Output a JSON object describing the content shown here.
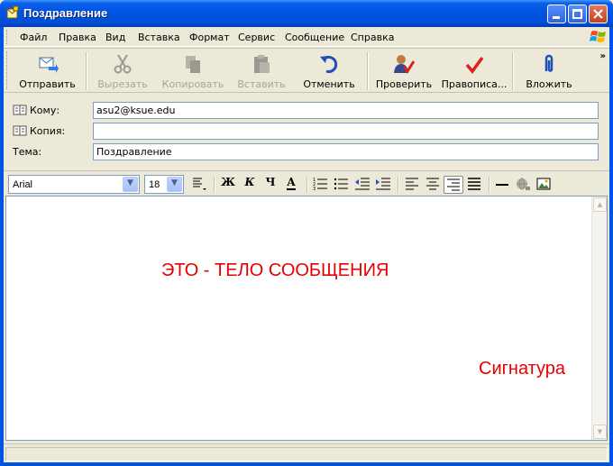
{
  "window": {
    "title": "Поздравление"
  },
  "menu": {
    "items": [
      "Файл",
      "Правка",
      "Вид",
      "Вставка",
      "Формат",
      "Сервис",
      "Сообщение",
      "Справка"
    ]
  },
  "toolbar": {
    "buttons": [
      {
        "label": "Отправить",
        "icon": "send-mail-icon",
        "enabled": true
      },
      {
        "label": "Вырезать",
        "icon": "scissors-icon",
        "enabled": false
      },
      {
        "label": "Копировать",
        "icon": "copy-icon",
        "enabled": false
      },
      {
        "label": "Вставить",
        "icon": "paste-icon",
        "enabled": false
      },
      {
        "label": "Отменить",
        "icon": "undo-icon",
        "enabled": true
      },
      {
        "label": "Проверить",
        "icon": "check-names-icon",
        "enabled": true
      },
      {
        "label": "Правописа...",
        "icon": "spelling-icon",
        "enabled": true
      },
      {
        "label": "Вложить",
        "icon": "paperclip-icon",
        "enabled": true
      }
    ]
  },
  "header": {
    "to_label": "Кому:",
    "to_value": "asu2@ksue.edu",
    "cc_label": "Копия:",
    "cc_value": "",
    "subject_label": "Тема:",
    "subject_value": "Поздравление"
  },
  "format": {
    "font": "Arial",
    "size": "18",
    "bold": "Ж",
    "italic": "К",
    "underline": "Ч",
    "font_color": "А",
    "align_active": "align-right"
  },
  "body": {
    "text": "ЭТО - ТЕЛО СООБЩЕНИЯ",
    "signature": "Сигнатура",
    "text_color": "#e60000"
  }
}
